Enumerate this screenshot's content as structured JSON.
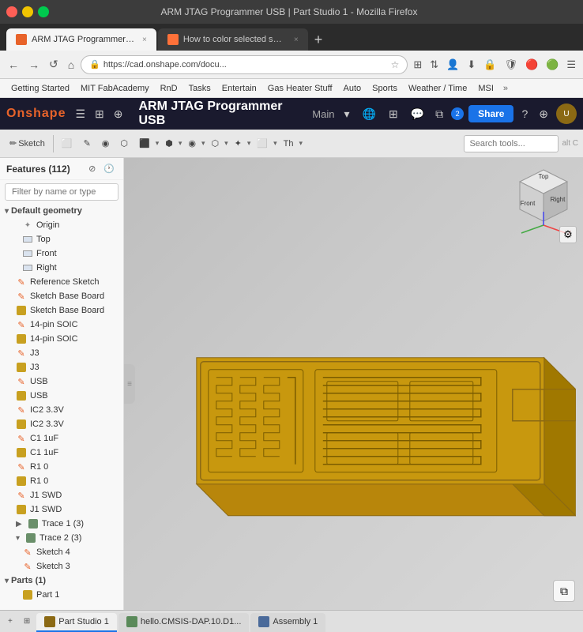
{
  "browser": {
    "title": "ARM JTAG Programmer USB | Part Studio 1 - Mozilla Firefox",
    "tabs": [
      {
        "id": "tab1",
        "label": "ARM JTAG Programmer US...",
        "active": true,
        "favicon": "onshape"
      },
      {
        "id": "tab2",
        "label": "How to color selected surf...",
        "active": false,
        "favicon": "firefox"
      }
    ],
    "address": "https://cad.onshape.com/docu...",
    "bookmarks": [
      "Getting Started",
      "MIT FabAcademy",
      "RnD",
      "Tasks",
      "Entertain",
      "Gas Heater Stuff",
      "Auto",
      "Sports",
      "Weather / Time",
      "MSI"
    ]
  },
  "app": {
    "logo": "Onshape",
    "doc_title": "ARM JTAG Programmer USB",
    "doc_branch": "Main",
    "share_label": "Share",
    "topbar_icons": [
      "☰",
      "⚙",
      "+"
    ],
    "toolbar": {
      "buttons": [
        "Sketch",
        "⬜",
        "✏",
        "🔧",
        "◯",
        "⬡",
        "⬜",
        "▽",
        "✦",
        "⬢",
        "◻",
        "◻",
        "Th",
        "▽"
      ],
      "search_placeholder": "Search tools...",
      "search_shortcut": "alt C"
    }
  },
  "sidebar": {
    "title": "Features",
    "count": 112,
    "filter_placeholder": "Filter by name or type",
    "groups": [
      {
        "name": "Default geometry",
        "expanded": true,
        "items": [
          {
            "label": "Origin",
            "type": "origin"
          },
          {
            "label": "Top",
            "type": "plane"
          },
          {
            "label": "Front",
            "type": "plane"
          },
          {
            "label": "Right",
            "type": "plane"
          }
        ]
      }
    ],
    "features": [
      {
        "label": "Reference Sketch",
        "type": "sketch",
        "indent": 0
      },
      {
        "label": "Sketch Base Board",
        "type": "sketch",
        "indent": 0
      },
      {
        "label": "Sketch Base Board",
        "type": "extrude",
        "indent": 0
      },
      {
        "label": "14-pin SOIC",
        "type": "sketch",
        "indent": 0
      },
      {
        "label": "14-pin SOIC",
        "type": "extrude",
        "indent": 0
      },
      {
        "label": "J3",
        "type": "sketch",
        "indent": 0
      },
      {
        "label": "J3",
        "type": "extrude",
        "indent": 0
      },
      {
        "label": "USB",
        "type": "sketch",
        "indent": 0
      },
      {
        "label": "USB",
        "type": "extrude",
        "indent": 0
      },
      {
        "label": "IC2 3.3V",
        "type": "sketch",
        "indent": 0
      },
      {
        "label": "IC2 3.3V",
        "type": "extrude",
        "indent": 0
      },
      {
        "label": "C1 1uF",
        "type": "sketch",
        "indent": 0
      },
      {
        "label": "C1 1uF",
        "type": "extrude",
        "indent": 0
      },
      {
        "label": "R1 0",
        "type": "sketch",
        "indent": 0
      },
      {
        "label": "R1 0",
        "type": "extrude",
        "indent": 0
      },
      {
        "label": "J1 SWD",
        "type": "sketch",
        "indent": 0
      },
      {
        "label": "J1 SWD",
        "type": "extrude",
        "indent": 0
      },
      {
        "label": "Trace 1 (3)",
        "type": "group_collapsed",
        "indent": 0
      },
      {
        "label": "Trace 2 (3)",
        "type": "group_expanded",
        "indent": 0
      },
      {
        "label": "Sketch 4",
        "type": "sketch",
        "indent": 1
      },
      {
        "label": "Sketch 3",
        "type": "sketch",
        "indent": 1
      }
    ],
    "parts_group": {
      "label": "Parts (1)",
      "expanded": true,
      "items": [
        {
          "label": "Part 1",
          "type": "part"
        }
      ]
    }
  },
  "bottom_tabs": [
    {
      "label": "Part Studio 1",
      "active": true,
      "icon": "studio"
    },
    {
      "label": "hello.CMSIS-DAP.10.D1...",
      "active": false,
      "icon": "file"
    },
    {
      "label": "Assembly 1",
      "active": false,
      "icon": "assembly"
    }
  ],
  "viewport": {
    "cube_faces": {
      "top": "Top",
      "front": "Front",
      "right": "Right"
    }
  },
  "icons": {
    "back": "←",
    "forward": "→",
    "reload": "↺",
    "home": "⌂",
    "lock": "🔒",
    "star": "☆",
    "menu": "☰",
    "search": "🔍",
    "close": "×",
    "chevron_down": "▾",
    "chevron_right": "▶",
    "chevron_left": "◀",
    "expand": "⊞",
    "collapse": "⊟",
    "add": "+",
    "settings": "⚙",
    "help": "?",
    "globe": "🌐",
    "notification": "💬",
    "share_icon": "↗",
    "copy": "⧉",
    "filter": "⊘",
    "clock": "🕐"
  }
}
